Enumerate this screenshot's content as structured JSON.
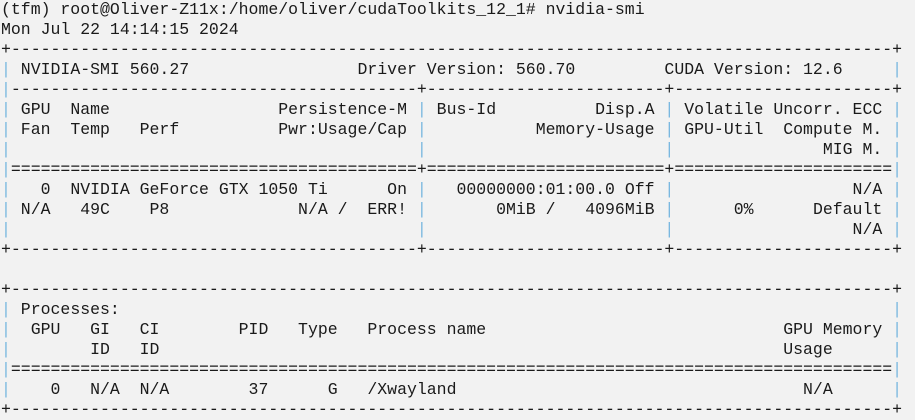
{
  "terminal": {
    "prompt": "(tfm) root@Oliver-Z11x:/home/oliver/cudaToolkits_12_1# nvidia-smi",
    "date": "Mon Jul 22 14:14:15 2024",
    "gpu_table": [
      "+-----------------------------------------------------------------------------------------+",
      "| NVIDIA-SMI 560.27                 Driver Version: 560.70         CUDA Version: 12.6     |",
      "|-----------------------------------------+------------------------+----------------------+",
      "| GPU  Name                 Persistence-M | Bus-Id          Disp.A | Volatile Uncorr. ECC |",
      "| Fan  Temp   Perf          Pwr:Usage/Cap |           Memory-Usage | GPU-Util  Compute M. |",
      "|                                         |                        |               MIG M. |",
      "|=========================================+========================+======================|",
      "|   0  NVIDIA GeForce GTX 1050 Ti      On |   00000000:01:00.0 Off |                  N/A |",
      "| N/A   49C    P8             N/A /  ERR! |       0MiB /   4096MiB |      0%      Default |",
      "|                                         |                        |                  N/A |",
      "+-----------------------------------------+------------------------+----------------------+"
    ],
    "spacer": " ",
    "process_table": [
      "+-----------------------------------------------------------------------------------------+",
      "| Processes:                                                                              |",
      "|  GPU   GI   CI        PID   Type   Process name                              GPU Memory |",
      "|        ID   ID                                                               Usage      |",
      "|=========================================================================================|",
      "|    0   N/A  N/A        37      G   /Xwayland                                   N/A      |",
      "+-----------------------------------------------------------------------------------------+"
    ],
    "colors": {
      "background": "#f2f2f2",
      "text": "#1a1a1a",
      "border_bar": "#7ab8e0"
    }
  }
}
